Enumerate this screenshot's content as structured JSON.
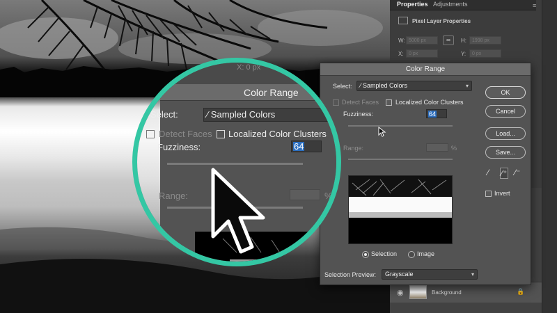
{
  "properties_panel": {
    "tab_active": "Properties",
    "tab_inactive": "Adjustments",
    "menu_icon": "panel-menu-icon",
    "title": "Pixel Layer Properties",
    "w_label": "W:",
    "w_value": "5000 px",
    "h_label": "H:",
    "h_value": "1998 px",
    "x_label": "X:",
    "x_value": "0 px",
    "y_label": "Y:",
    "y_value": "0 px",
    "link_icon": "link-icon"
  },
  "layers_panel": {
    "layer_name": "Background",
    "eye_icon": "eye-icon",
    "lock_icon": "lock-icon"
  },
  "dialog": {
    "title": "Color Range",
    "select_label": "Select:",
    "select_value": "Sampled Colors",
    "detect_faces": "Detect Faces",
    "detect_faces_checked": false,
    "localized_clusters": "Localized Color Clusters",
    "localized_clusters_checked": false,
    "fuzziness_label": "Fuzziness:",
    "fuzziness_value": "64",
    "range_label": "Range:",
    "range_unit": "%",
    "selection_label": "Selection",
    "image_label": "Image",
    "selected_view": "Selection",
    "selection_preview_label": "Selection Preview:",
    "selection_preview_value": "Grayscale",
    "buttons": {
      "ok": "OK",
      "cancel": "Cancel",
      "load": "Load...",
      "save": "Save..."
    },
    "invert_label": "Invert",
    "invert_checked": false,
    "eyedroppers": [
      "eyedropper-icon",
      "eyedropper-plus-icon",
      "eyedropper-minus-icon"
    ]
  },
  "magnifier": {
    "x_label": "X:",
    "x_value": "0 px",
    "title": "Color Range",
    "select_label": "Select:",
    "select_value": "Sampled Colors",
    "detect_faces": "Detect Faces",
    "localized_clusters": "Localized Color Clusters",
    "fuzziness_label": "Fuzziness:",
    "fuzziness_value": "64",
    "range_label": "Range:",
    "range_unit": "%",
    "ring_color": "#34c7a4"
  }
}
